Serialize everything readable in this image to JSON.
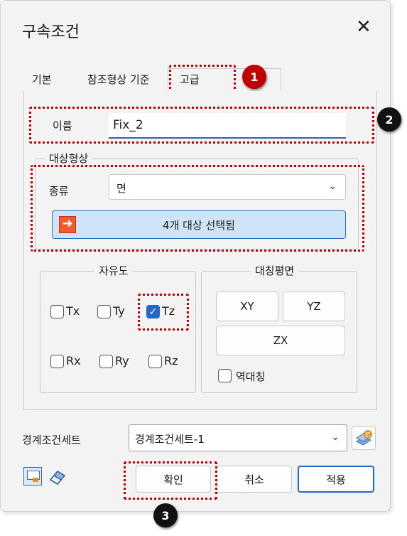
{
  "dialog": {
    "title": "구속조건",
    "close_glyph": "✕"
  },
  "tabs": [
    {
      "label": "기본"
    },
    {
      "label": "참조형상 기준"
    },
    {
      "label": "고급"
    }
  ],
  "markers": [
    "1",
    "2",
    "3"
  ],
  "name_field": {
    "label": "이름",
    "value": "Fix_2"
  },
  "target_shape": {
    "title": "대상형상",
    "type_label": "종류",
    "type_value": "면",
    "select_button": "4개 대상 선택됨"
  },
  "dof": {
    "title": "자유도",
    "items": [
      {
        "label": "Tx",
        "checked": false
      },
      {
        "label": "Ty",
        "checked": false
      },
      {
        "label": "Tz",
        "checked": true
      },
      {
        "label": "Rx",
        "checked": false
      },
      {
        "label": "Ry",
        "checked": false
      },
      {
        "label": "Rz",
        "checked": false
      }
    ]
  },
  "symmetry": {
    "title": "대칭평면",
    "buttons": [
      "XY",
      "YZ",
      "ZX"
    ],
    "reverse_label": "역대칭",
    "reverse_checked": false
  },
  "bc_set": {
    "label": "경계조건세트",
    "value": "경계조건세트-1"
  },
  "footer": {
    "ok": "확인",
    "cancel": "취소",
    "apply": "적용"
  },
  "colors": {
    "marker_red": "#c00000",
    "marker_black": "#111111",
    "accent_blue": "#2467c5"
  },
  "icons": [
    "arrow-select-icon",
    "bc-set-icon",
    "preview-icon",
    "eraser-icon",
    "chevron-down-icon",
    "check-icon"
  ]
}
